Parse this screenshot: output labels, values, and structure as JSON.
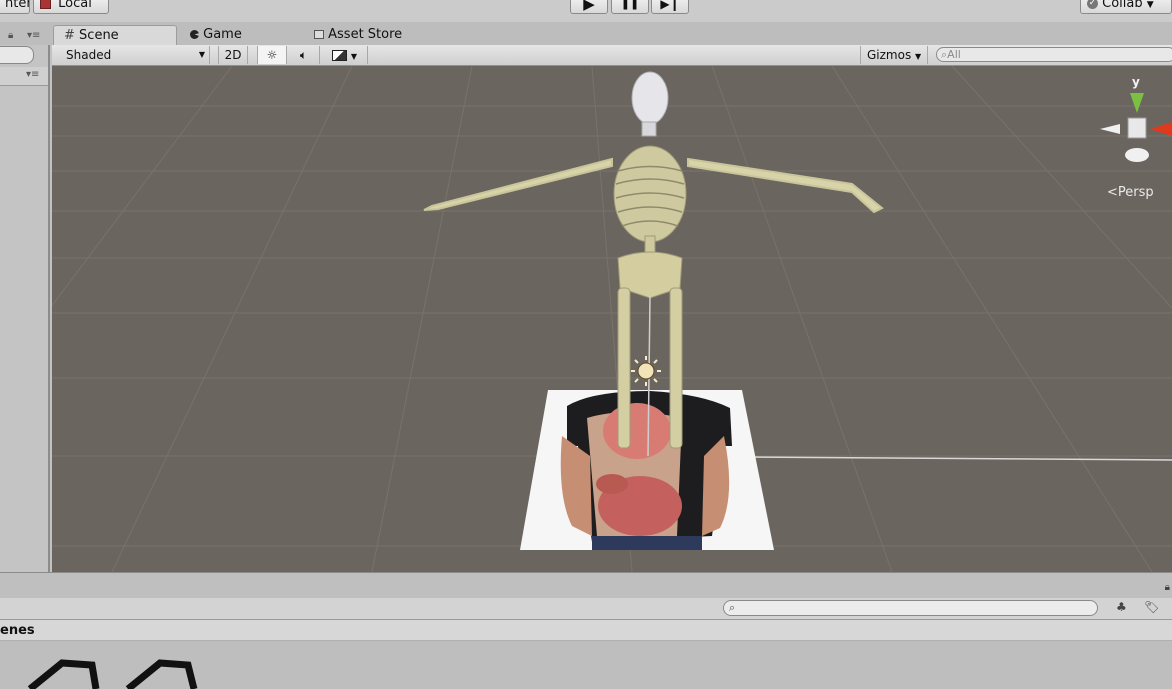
{
  "toolbar": {
    "center_label": "nter",
    "local_label": "Local",
    "play_glyph": "▶",
    "pause_glyph": "❚❚",
    "step_glyph": "▶❙",
    "collab_label": "Collab"
  },
  "tabs": [
    {
      "label": "Scene",
      "icon": "grid-icon"
    },
    {
      "label": "Game",
      "icon": "pacman-icon"
    },
    {
      "label": "Asset Store",
      "icon": "store-icon"
    }
  ],
  "scene_toolbar": {
    "draw_mode": "Shaded",
    "mode_2d": "2D",
    "gizmos_label": "Gizmos",
    "search_placeholder": "All"
  },
  "viewport": {
    "axis_y_label": "y",
    "projection_label": "Persp",
    "colors": {
      "floor": "#6b6560",
      "grid": "#7a746e",
      "axis_y": "#7bc043",
      "axis_x": "#e03a1e"
    }
  },
  "bottom": {
    "scenes_label": "enes"
  }
}
